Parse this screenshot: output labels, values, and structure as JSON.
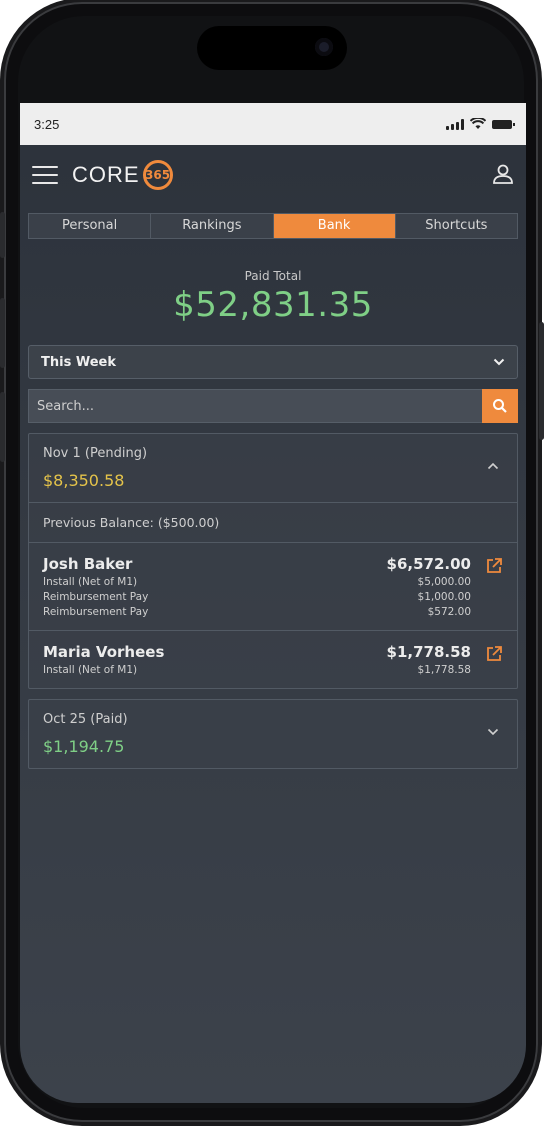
{
  "status": {
    "time": "3:25"
  },
  "app": {
    "logo_text": "CORE",
    "logo_mark": "365"
  },
  "tabs": [
    {
      "label": "Personal"
    },
    {
      "label": "Rankings"
    },
    {
      "label": "Bank"
    },
    {
      "label": "Shortcuts"
    }
  ],
  "paid": {
    "label": "Paid Total",
    "amount": "$52,831.35"
  },
  "period": {
    "selected": "This Week"
  },
  "search": {
    "placeholder": "Search..."
  },
  "groups": [
    {
      "title": "Nov 1 (Pending)",
      "amount": "$8,350.58",
      "amount_color": "#e4c34a",
      "expanded": true,
      "previous_balance": "Previous Balance: ($500.00)",
      "entries": [
        {
          "name": "Josh Baker",
          "total": "$6,572.00",
          "lines": [
            {
              "label": "Install (Net of M1)",
              "value": "$5,000.00"
            },
            {
              "label": "Reimbursement Pay",
              "value": "$1,000.00"
            },
            {
              "label": "Reimbursement Pay",
              "value": "$572.00"
            }
          ]
        },
        {
          "name": "Maria Vorhees",
          "total": "$1,778.58",
          "lines": [
            {
              "label": "Install (Net of M1)",
              "value": "$1,778.58"
            }
          ]
        }
      ]
    },
    {
      "title": "Oct 25 (Paid)",
      "amount": "$1,194.75",
      "amount_color": "#7fcf86",
      "expanded": false
    }
  ],
  "colors": {
    "accent": "#ef8a3d",
    "paid_green": "#7fcf86",
    "pending_yellow": "#e4c34a"
  }
}
